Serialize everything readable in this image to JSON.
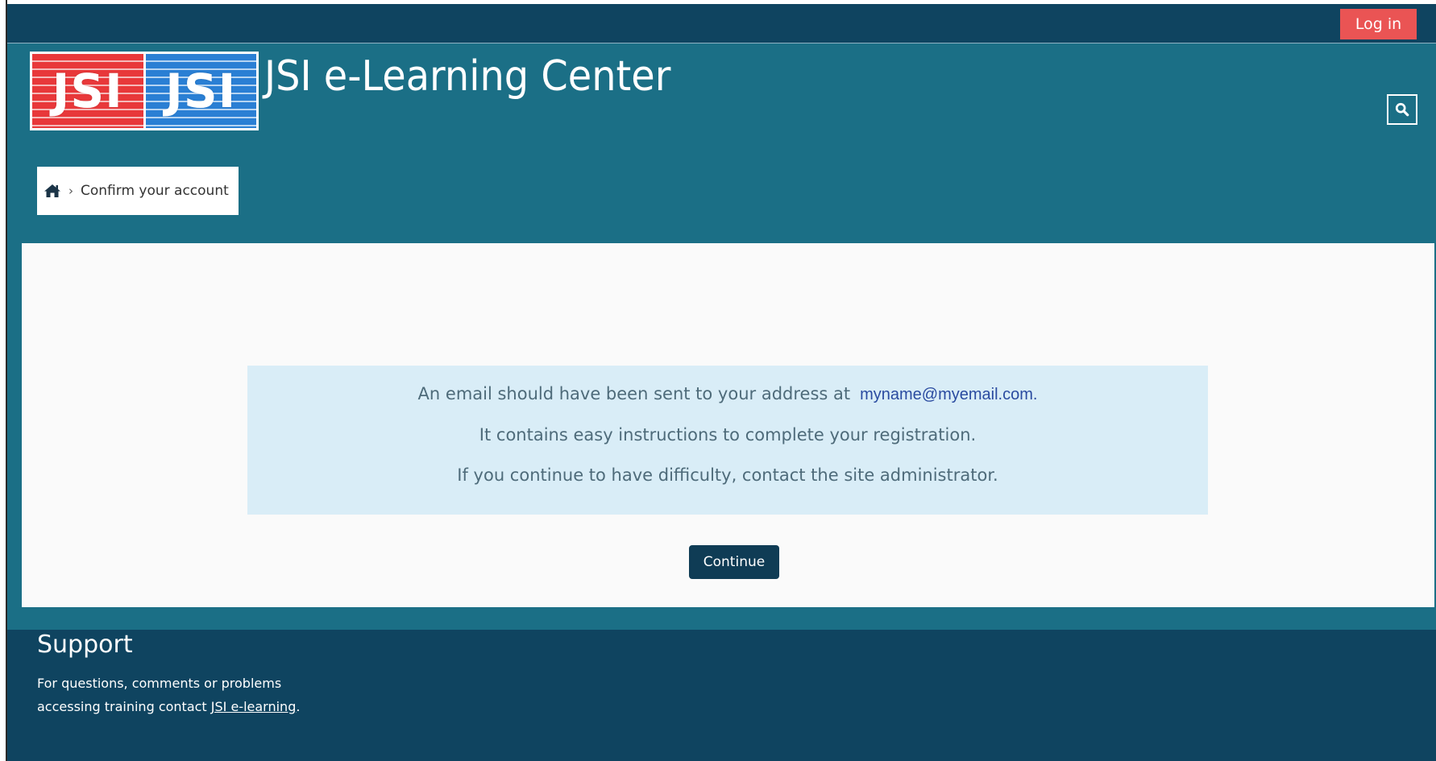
{
  "top_bar": {
    "login_label": "Log in"
  },
  "header": {
    "logo_left_text": "JSI",
    "logo_right_text": "JSI",
    "site_title": "JSI e-Learning Center"
  },
  "breadcrumb": {
    "current_page": "Confirm your account"
  },
  "main": {
    "alert": {
      "line1": "An email should have been sent to your address at",
      "email": "myname@myemail.com.",
      "line2": "It contains easy instructions to complete your registration.",
      "line3": "If you continue to have difficulty, contact the site administrator."
    },
    "continue_label": "Continue"
  },
  "footer": {
    "heading": "Support",
    "text_line1": "For questions, comments or problems",
    "text_line2_prefix": "accessing training contact ",
    "link_text": "JSI e-learning",
    "text_suffix": "."
  },
  "colors": {
    "top_bar_bg": "#0f4460",
    "header_bg": "#1b6f86",
    "login_button_bg": "#ea5454",
    "alert_bg": "#d9edf7",
    "continue_button_bg": "#0f3c55",
    "email_color": "#2a4ba0"
  },
  "icons": {
    "breadcrumb_home": "home-icon",
    "search": "search-icon"
  }
}
